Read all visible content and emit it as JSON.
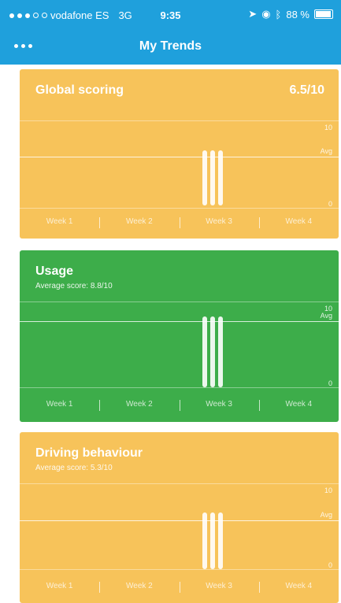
{
  "status_bar": {
    "carrier": "vodafone ES",
    "network": "3G",
    "time": "9:35",
    "battery": "88 %"
  },
  "nav": {
    "title": "My Trends",
    "menu_icon": "more-dots-icon"
  },
  "cards": [
    {
      "title": "Global scoring",
      "score": "6.5/10",
      "subtitle": "",
      "color": "#f7c35a",
      "top_label": "10",
      "avg_label": "Avg",
      "bottom_label": "0",
      "weeks": [
        "Week 1",
        "Week 2",
        "Week 3",
        "Week 4"
      ]
    },
    {
      "title": "Usage",
      "score": "",
      "subtitle": "Average score: 8.8/10",
      "color": "#3dad4a",
      "top_label": "10",
      "avg_label": "Avg",
      "bottom_label": "0",
      "weeks": [
        "Week 1",
        "Week 2",
        "Week 3",
        "Week 4"
      ]
    },
    {
      "title": "Driving behaviour",
      "score": "",
      "subtitle": "Average score: 5.3/10",
      "color": "#f7c35a",
      "top_label": "10",
      "avg_label": "Avg",
      "bottom_label": "0",
      "weeks": [
        "Week 1",
        "Week 2",
        "Week 3",
        "Week 4"
      ]
    }
  ]
}
